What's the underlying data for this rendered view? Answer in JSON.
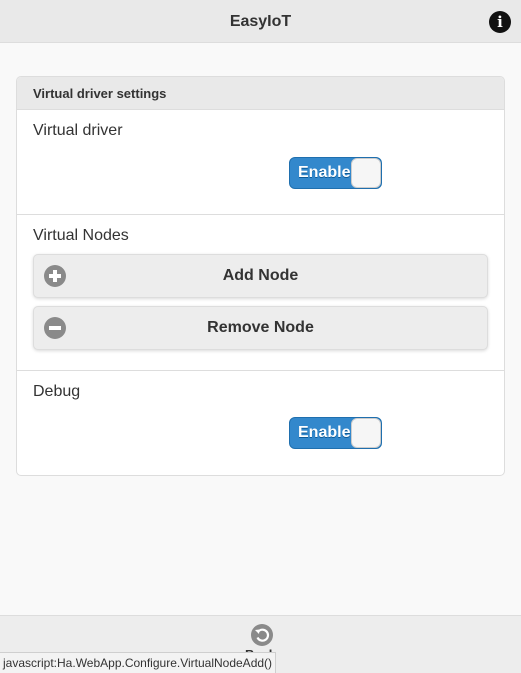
{
  "header": {
    "title": "EasyIoT",
    "info_icon": "info-icon"
  },
  "panel": {
    "title": "Virtual driver settings",
    "virtual_driver": {
      "label": "Virtual driver",
      "switch_label": "Enable"
    },
    "virtual_nodes": {
      "label": "Virtual Nodes",
      "add_button": "Add Node",
      "add_icon": "plus-icon",
      "remove_button": "Remove Node",
      "remove_icon": "minus-icon"
    },
    "debug": {
      "label": "Debug",
      "switch_label": "Enable"
    }
  },
  "footer": {
    "back_label": "Back",
    "back_icon": "back-icon"
  },
  "statusbar": {
    "text": "javascript:Ha.WebApp.Configure.VirtualNodeAdd()"
  },
  "colors": {
    "accent": "#3388cc",
    "header_bg": "#e9e9e9",
    "page_bg": "#f9f9f9"
  }
}
